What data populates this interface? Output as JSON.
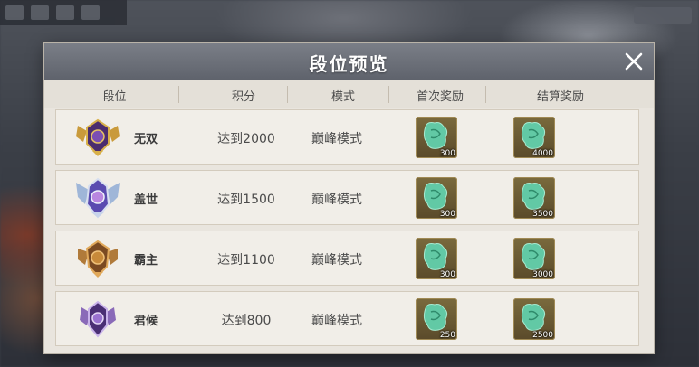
{
  "dialog": {
    "title": "段位预览",
    "close_icon": "close-icon"
  },
  "columns": {
    "rank": "段位",
    "score": "积分",
    "mode": "模式",
    "first_reward": "首次奖励",
    "settle_reward": "结算奖励"
  },
  "colors": {
    "header": "#6b6f78",
    "panel": "#e9e5de",
    "row": "#f1eee8",
    "reward_frame": "#6a5a33",
    "reward_item": "#5fc7a4"
  },
  "rows": [
    {
      "name": "无双",
      "score": "达到2000",
      "mode": "巅峰模式",
      "first_qty": "300",
      "settle_qty": "4000",
      "emblem": "purple-gold-crest-icon"
    },
    {
      "name": "盖世",
      "score": "达到1500",
      "mode": "巅峰模式",
      "first_qty": "300",
      "settle_qty": "3500",
      "emblem": "blue-silver-crest-icon"
    },
    {
      "name": "霸主",
      "score": "达到1100",
      "mode": "巅峰模式",
      "first_qty": "300",
      "settle_qty": "3000",
      "emblem": "bronze-crest-icon"
    },
    {
      "name": "君候",
      "score": "达到800",
      "mode": "巅峰模式",
      "first_qty": "250",
      "settle_qty": "2500",
      "emblem": "purple-crest-icon"
    }
  ]
}
